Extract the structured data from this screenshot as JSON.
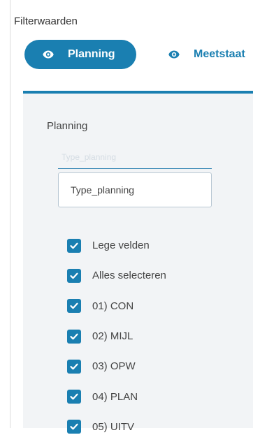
{
  "panel": {
    "title": "Filterwaarden"
  },
  "tabs": [
    {
      "label": "Planning",
      "icon": "eye-icon",
      "active": true
    },
    {
      "label": "Meetstaat",
      "icon": "eye-icon",
      "active": false
    }
  ],
  "filter": {
    "section_title": "Planning",
    "field_label": "Type_planning",
    "search_placeholder": "Type_planning",
    "options": [
      {
        "label": "Lege velden",
        "checked": true
      },
      {
        "label": "Alles selecteren",
        "checked": true
      },
      {
        "label": "01) CON",
        "checked": true
      },
      {
        "label": "02) MIJL",
        "checked": true
      },
      {
        "label": "03) OPW",
        "checked": true
      },
      {
        "label": "04) PLAN",
        "checked": true
      },
      {
        "label": "05) UITV",
        "checked": true
      }
    ]
  },
  "colors": {
    "accent": "#1a7fb1",
    "content_background": "#f2f4f6",
    "text": "#444444"
  }
}
